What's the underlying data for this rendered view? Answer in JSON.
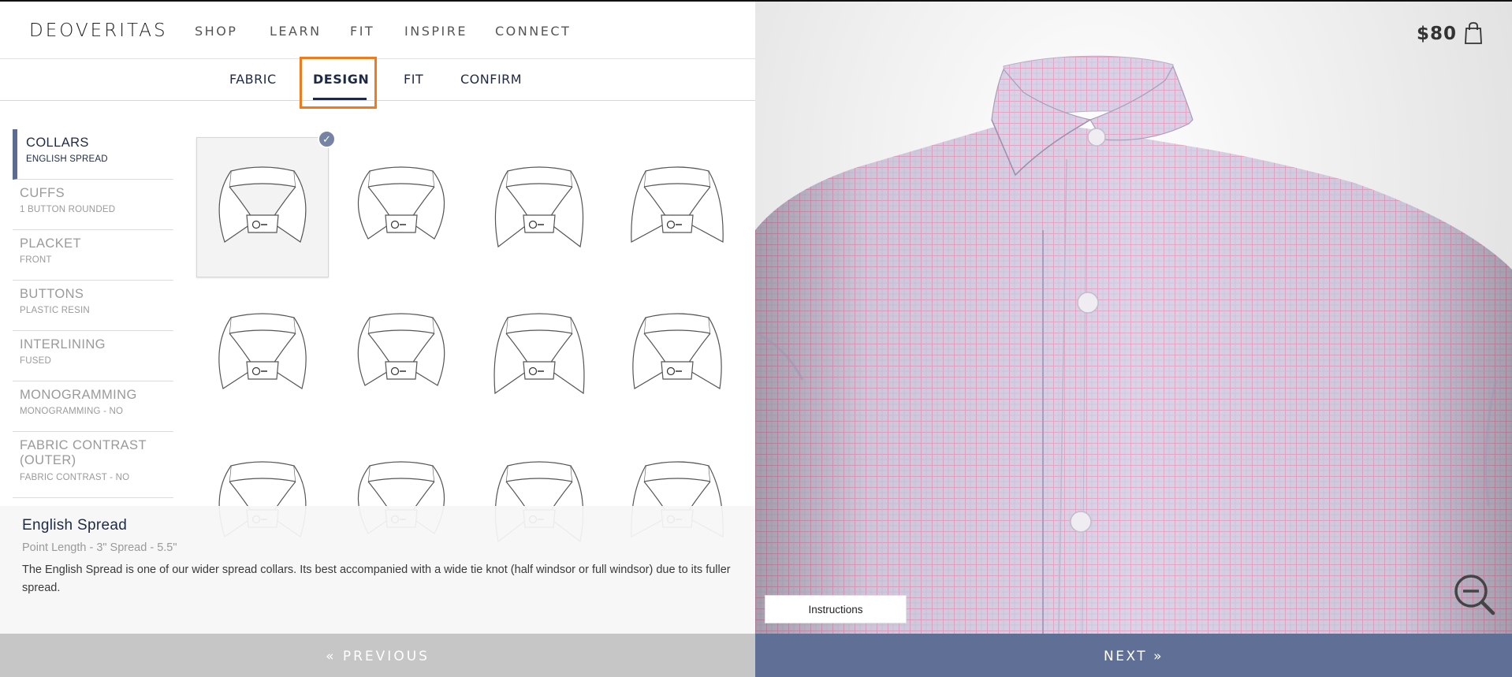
{
  "brand": "DEOVERITAS",
  "nav": [
    "SHOP",
    "LEARN",
    "FIT",
    "INSPIRE",
    "CONNECT"
  ],
  "steps": [
    "FABRIC",
    "DESIGN",
    "FIT",
    "CONFIRM"
  ],
  "active_step": "DESIGN",
  "sidebar": [
    {
      "title": "COLLARS",
      "sub": "ENGLISH SPREAD",
      "active": true
    },
    {
      "title": "CUFFS",
      "sub": "1 BUTTON ROUNDED"
    },
    {
      "title": "PLACKET",
      "sub": "FRONT"
    },
    {
      "title": "BUTTONS",
      "sub": "PLASTIC RESIN"
    },
    {
      "title": "INTERLINING",
      "sub": "FUSED"
    },
    {
      "title": "MONOGRAMMING",
      "sub": "MONOGRAMMING - NO"
    },
    {
      "title": "FABRIC CONTRAST (OUTER)",
      "sub": "FABRIC CONTRAST - NO"
    }
  ],
  "collar_grid": {
    "selected_index": 0,
    "check_icon": "check-icon"
  },
  "description": {
    "title": "English Spread",
    "spec": "Point Length - 3\" Spread - 5.5\"",
    "text": "The English Spread is one of our wider spread collars. Its best accompanied with a wide tie knot (half windsor or full windsor) due to its fuller spread."
  },
  "footer": {
    "previous": "« PREVIOUS",
    "next": "NEXT »"
  },
  "preview": {
    "price": "$80",
    "instructions": "Instructions",
    "icons": [
      "shopping-bag-icon",
      "zoom-out-icon"
    ]
  },
  "colors": {
    "navy": "#1e2a44",
    "accent_orange": "#f07a1c",
    "next_bg": "#5f6f96",
    "prev_bg": "#c6c6c6",
    "shirt": "#d9d1e6",
    "check": "#e6a3c4"
  }
}
